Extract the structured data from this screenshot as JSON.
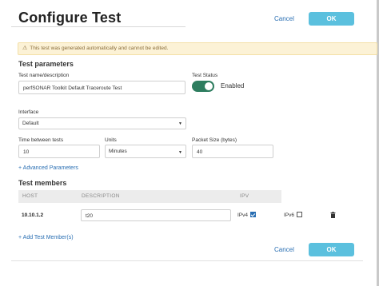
{
  "header": {
    "title": "Configure Test",
    "cancel_label": "Cancel",
    "ok_label": "OK"
  },
  "warning": {
    "icon": "warning-triangle-icon",
    "text": "This test was generated automatically and cannot be edited."
  },
  "parameters": {
    "section_title": "Test parameters",
    "name_label": "Test name/description",
    "name_value": "perfSONAR Toolkit Default Traceroute Test",
    "status_label": "Test Status",
    "status_value": "Enabled",
    "status_on": true,
    "interface_label": "Interface",
    "interface_value": "Default",
    "between_label": "Time between tests",
    "between_value": "10",
    "units_label": "Units",
    "units_value": "Minutes",
    "packet_label": "Packet Size (bytes)",
    "packet_value": "40",
    "advanced_link": "+ Advanced Parameters"
  },
  "members": {
    "section_title": "Test members",
    "columns": [
      "HOST",
      "DESCRIPTION",
      "IPV"
    ],
    "rows": [
      {
        "host": "10.10.1.2",
        "description": "t20",
        "ipv4_label": "IPv4",
        "ipv4_checked": true,
        "ipv6_label": "IPv6",
        "ipv6_checked": false
      }
    ],
    "add_link": "+ Add Test Member(s)"
  },
  "footer": {
    "cancel_label": "Cancel",
    "ok_label": "OK"
  },
  "colors": {
    "accent": "#5bc0de",
    "link": "#2a6fb3",
    "toggle_on": "#2e7d5f",
    "warning_bg": "#fcf2d6"
  }
}
